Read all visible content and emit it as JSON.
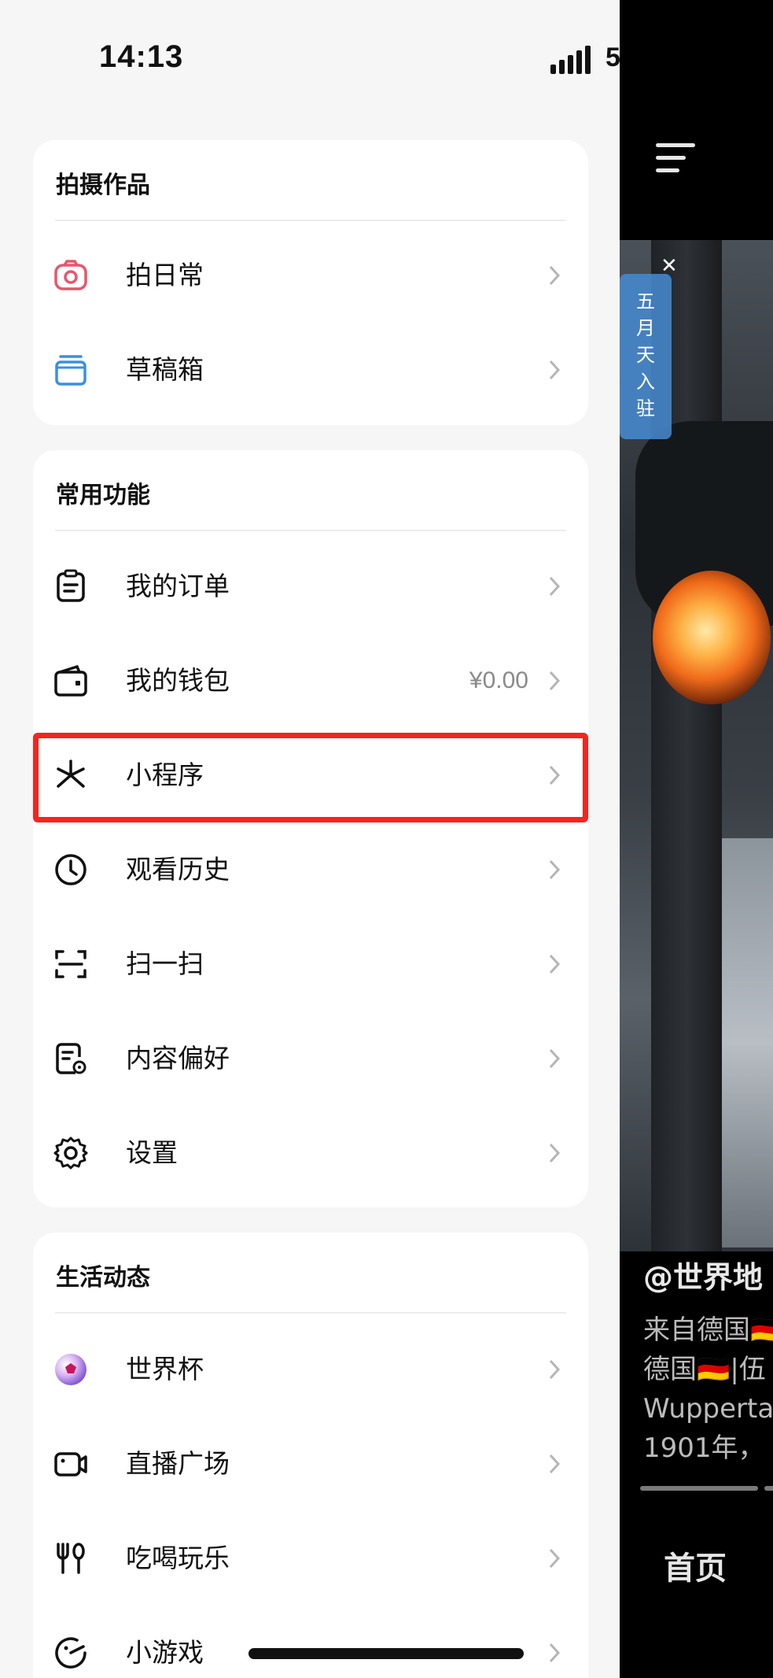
{
  "status_bar": {
    "time": "14:13",
    "network": "5"
  },
  "sections": [
    {
      "title": "拍摄作品",
      "items": [
        {
          "label": "拍日常",
          "icon": "camera-icon"
        },
        {
          "label": "草稿箱",
          "icon": "drafts-icon"
        }
      ]
    },
    {
      "title": "常用功能",
      "items": [
        {
          "label": "我的订单",
          "icon": "order-icon"
        },
        {
          "label": "我的钱包",
          "icon": "wallet-icon",
          "value": "¥0.00"
        },
        {
          "label": "小程序",
          "icon": "mini-program-icon",
          "highlighted": true
        },
        {
          "label": "观看历史",
          "icon": "clock-icon"
        },
        {
          "label": "扫一扫",
          "icon": "scan-icon"
        },
        {
          "label": "内容偏好",
          "icon": "content-preference-icon"
        },
        {
          "label": "设置",
          "icon": "gear-icon"
        }
      ]
    },
    {
      "title": "生活动态",
      "items": [
        {
          "label": "世界杯",
          "icon": "soccer-ball-icon"
        },
        {
          "label": "直播广场",
          "icon": "live-camera-icon"
        },
        {
          "label": "吃喝玩乐",
          "icon": "fork-knife-icon"
        },
        {
          "label": "小游戏",
          "icon": "game-icon"
        }
      ]
    }
  ],
  "feed": {
    "badge_text": [
      "五",
      "月",
      "天",
      "入",
      "驻"
    ],
    "author": "@世界地",
    "description_lines": [
      "来自德国🇩🇪",
      "德国🇩🇪|伍",
      "Wupperta",
      "1901年，"
    ],
    "tab_home": "首页"
  },
  "colors": {
    "highlight": "#f4251e",
    "camera_icon": "#e8566c",
    "drafts_icon": "#3b8fe0"
  }
}
